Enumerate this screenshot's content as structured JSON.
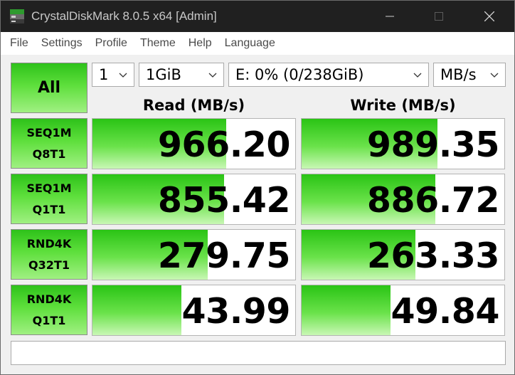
{
  "window": {
    "title": "CrystalDiskMark 8.0.5 x64 [Admin]"
  },
  "menu": [
    "File",
    "Settings",
    "Profile",
    "Theme",
    "Help",
    "Language"
  ],
  "controls": {
    "all_label": "All",
    "count": "1",
    "size": "1GiB",
    "drive": "E: 0% (0/238GiB)",
    "unit": "MB/s"
  },
  "headers": {
    "read": "Read (MB/s)",
    "write": "Write (MB/s)"
  },
  "tests": [
    {
      "line1": "SEQ1M",
      "line2": "Q8T1",
      "read": "966.20",
      "write": "989.35",
      "read_fill": 0.66,
      "write_fill": 0.67
    },
    {
      "line1": "SEQ1M",
      "line2": "Q1T1",
      "read": "855.42",
      "write": "886.72",
      "read_fill": 0.65,
      "write_fill": 0.66
    },
    {
      "line1": "RND4K",
      "line2": "Q32T1",
      "read": "279.75",
      "write": "263.33",
      "read_fill": 0.57,
      "write_fill": 0.56
    },
    {
      "line1": "RND4K",
      "line2": "Q1T1",
      "read": "43.99",
      "write": "49.84",
      "read_fill": 0.44,
      "write_fill": 0.44
    }
  ],
  "comment": "",
  "colors": {
    "bar_top": "#2ac415",
    "bar_bottom": "#c9f7b5",
    "titlebar": "#202020"
  }
}
